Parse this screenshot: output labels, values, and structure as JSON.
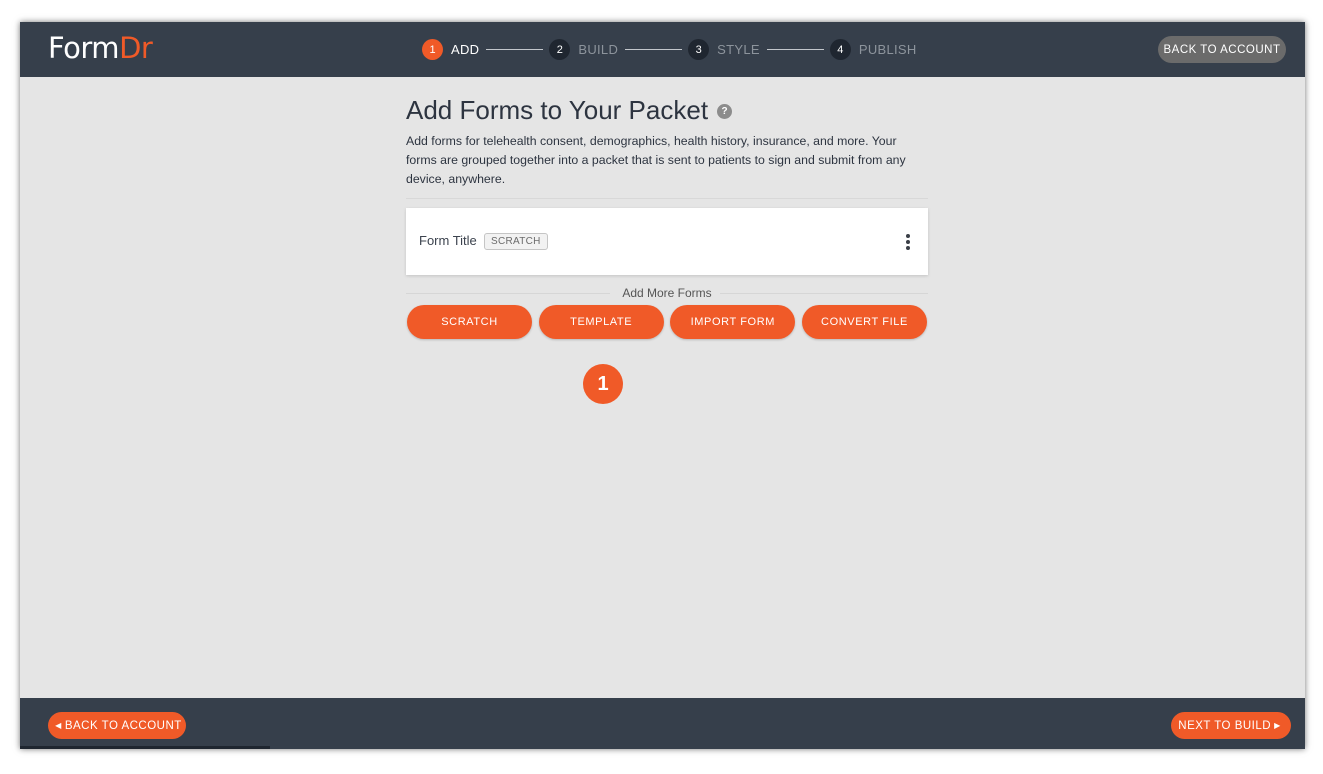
{
  "brand": {
    "name_part1": "Form",
    "name_part2": "Dr",
    "accent_color": "#f05a28",
    "bar_color": "#363f4b"
  },
  "steps": [
    {
      "num": "1",
      "label": "ADD",
      "active": true
    },
    {
      "num": "2",
      "label": "BUILD",
      "active": false
    },
    {
      "num": "3",
      "label": "STYLE",
      "active": false
    },
    {
      "num": "4",
      "label": "PUBLISH",
      "active": false
    }
  ],
  "header": {
    "back_to_account": "BACK TO ACCOUNT"
  },
  "main": {
    "title": "Add Forms to Your Packet",
    "help_icon": "?",
    "description": "Add forms for telehealth consent, demographics, health history, insurance, and more. Your forms are grouped together into a packet that is sent to patients to sign and submit from any device, anywhere.",
    "forms": [
      {
        "title": "Form Title",
        "badge": "SCRATCH"
      }
    ],
    "add_more_label": "Add More Forms",
    "add_buttons": {
      "scratch": "SCRATCH",
      "template": "TEMPLATE",
      "import_form": "IMPORT FORM",
      "convert_file": "CONVERT FILE"
    },
    "marker": "1"
  },
  "footer": {
    "back_label": "BACK TO ACCOUNT",
    "next_label": "NEXT TO BUILD",
    "left_caret": "◀",
    "right_caret": "▶"
  }
}
